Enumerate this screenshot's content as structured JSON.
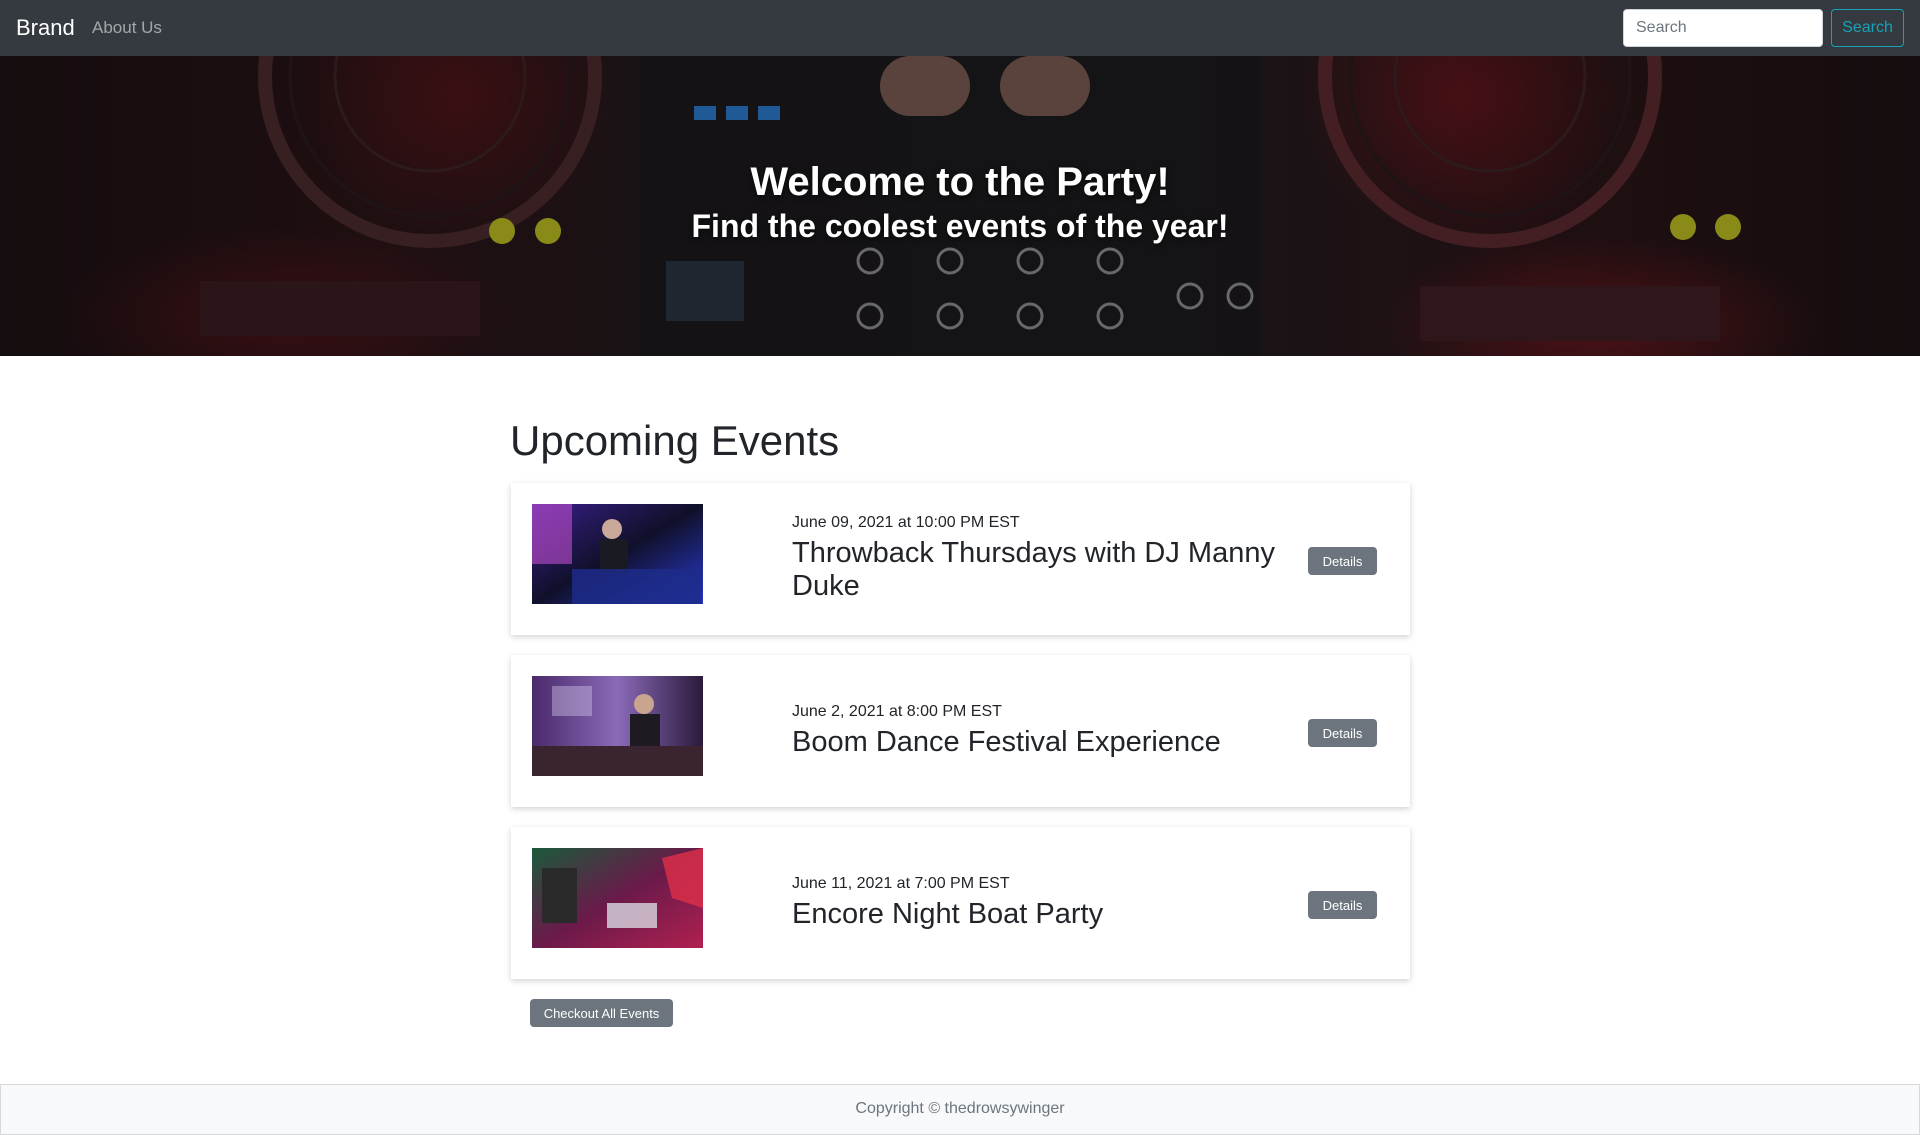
{
  "navbar": {
    "brand": "Brand",
    "links": [
      {
        "label": "About Us"
      }
    ],
    "search": {
      "placeholder": "Search",
      "button_label": "Search"
    }
  },
  "hero": {
    "title": "Welcome to the Party!",
    "subtitle": "Find the coolest events of the year!"
  },
  "events_section": {
    "title": "Upcoming Events",
    "events": [
      {
        "date": "June 09, 2021 at 10:00 PM EST",
        "title": "Throwback Thursdays with DJ Manny Duke",
        "button_label": "Details"
      },
      {
        "date": "June 2, 2021 at 8:00 PM EST",
        "title": "Boom Dance Festival Experience",
        "button_label": "Details"
      },
      {
        "date": "June 11, 2021 at 7:00 PM EST",
        "title": "Encore Night Boat Party",
        "button_label": "Details"
      }
    ],
    "all_events_label": "Checkout All Events"
  },
  "footer": {
    "copyright": "Copyright © thedrowsywinger"
  },
  "colors": {
    "navbar_bg": "#343a40",
    "search_accent": "#17a2b8",
    "button_secondary": "#6c757d",
    "footer_bg": "#f8f9fa"
  }
}
